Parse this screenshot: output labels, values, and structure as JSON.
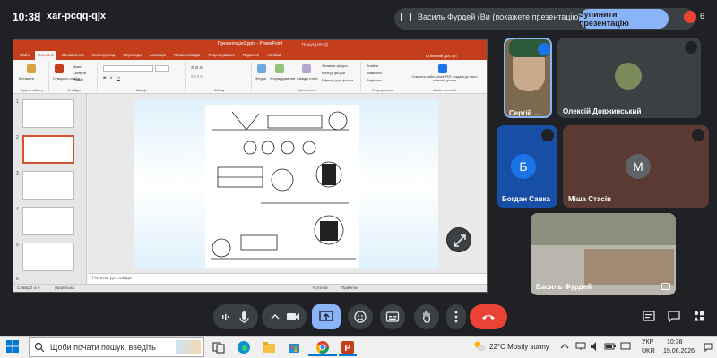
{
  "topbar": {
    "time": "10:38",
    "meeting_code": "xar-pcqq-qjx",
    "presenter_text": "Василь Фурдей (Ви (покажете презентацію))",
    "stop_label": "Зупинити презентацію",
    "people_count": "6"
  },
  "ppt": {
    "title": "Презентація1.pptx - PowerPoint",
    "search": "Пошук (Alt+Q)",
    "tabs": [
      "Файл",
      "Основне",
      "Вставлення",
      "Конструктор",
      "Переходи",
      "Анімація",
      "Показ слайдів",
      "Рецензування",
      "Подання",
      "Acrobat"
    ],
    "share": "Спільний доступ",
    "ribbon_groups": [
      "Буфер обміну",
      "Слайди",
      "Шрифт",
      "Абзац",
      "Креслення",
      "Редагування",
      "Adobe Acrobat"
    ],
    "ribbon_items": [
      "Вставити",
      "Створити слайд",
      "Макет",
      "Скинути",
      "Розділ",
      "Фігури",
      "Упорядкування",
      "Швидкі стилі",
      "Заливка фігури",
      "Контур фігури",
      "Ефекти для фігури",
      "Знайти",
      "Замінити",
      "Виділити",
      "Створити файл Adobe PDF і надати до нього спільний доступ"
    ],
    "thumb_numbers": [
      "1",
      "2",
      "3",
      "4",
      "5",
      "6"
    ],
    "notes_placeholder": "Нотатки до слайда",
    "status_left": "Слайд 2 із 6",
    "status_lang": "українська",
    "status_notes": "Нотатки",
    "status_comments": "Примітки"
  },
  "participants": [
    {
      "name": "Сергій ...",
      "type": "video"
    },
    {
      "name": "Олексій Довжинський",
      "type": "video"
    },
    {
      "name": "Богдан Савка",
      "initial": "Б",
      "type": "avatar",
      "color": "#1a73e8"
    },
    {
      "name": "Міша Стасів",
      "initial": "М",
      "type": "avatar",
      "color": "#5f6368"
    },
    {
      "name": "Василь Фурдей",
      "type": "video"
    }
  ],
  "colors": {
    "accent": "#8ab4f8",
    "end_call": "#ea4335",
    "present_active": "#8ab4f8",
    "ppt_brand": "#c43e1c"
  },
  "taskbar": {
    "search_placeholder": "Щоби почати пошук, введіть",
    "weather": "22°C  Mostly sunny",
    "lang_top": "УКР",
    "lang_bottom": "UKR",
    "clock_time": "10:38",
    "clock_date": "19.06.2026"
  },
  "icons": {
    "present": "present-screen-icon",
    "people": "people-icon",
    "mic": "mic-icon",
    "camera": "camera-icon",
    "emoji": "emoji-icon",
    "captions": "captions-icon",
    "hand": "raise-hand-icon",
    "more": "more-vert-icon",
    "end": "call-end-icon",
    "info": "info-icon",
    "chat": "chat-icon",
    "activities": "activities-icon",
    "lock": "lock-icon"
  }
}
